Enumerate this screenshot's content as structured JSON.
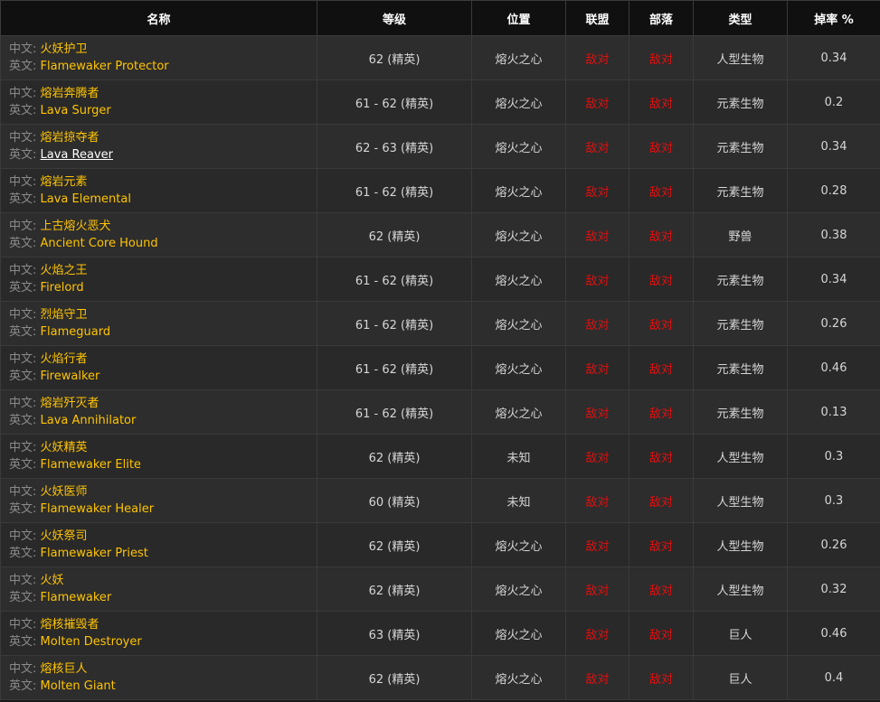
{
  "headers": {
    "name": "名称",
    "level": "等级",
    "location": "位置",
    "alliance": "联盟",
    "horde": "部落",
    "type": "类型",
    "droprate": "掉率 %"
  },
  "labels": {
    "cn": "中文:",
    "en": "英文:"
  },
  "rows": [
    {
      "cn": "火妖护卫",
      "en": "Flamewaker Protector",
      "level": "62 (精英)",
      "location": "熔火之心",
      "alliance": "敌对",
      "horde": "敌对",
      "type": "人型生物",
      "droprate": "0.34"
    },
    {
      "cn": "熔岩奔腾者",
      "en": "Lava Surger",
      "level": "61 - 62 (精英)",
      "location": "熔火之心",
      "alliance": "敌对",
      "horde": "敌对",
      "type": "元素生物",
      "droprate": "0.2"
    },
    {
      "cn": "熔岩掠夺者",
      "en": "Lava Reaver",
      "level": "62 - 63 (精英)",
      "location": "熔火之心",
      "alliance": "敌对",
      "horde": "敌对",
      "type": "元素生物",
      "droprate": "0.34"
    },
    {
      "cn": "熔岩元素",
      "en": "Lava Elemental",
      "level": "61 - 62 (精英)",
      "location": "熔火之心",
      "alliance": "敌对",
      "horde": "敌对",
      "type": "元素生物",
      "droprate": "0.28"
    },
    {
      "cn": "上古熔火恶犬",
      "en": "Ancient Core Hound",
      "level": "62 (精英)",
      "location": "熔火之心",
      "alliance": "敌对",
      "horde": "敌对",
      "type": "野兽",
      "droprate": "0.38"
    },
    {
      "cn": "火焰之王",
      "en": "Firelord",
      "level": "61 - 62 (精英)",
      "location": "熔火之心",
      "alliance": "敌对",
      "horde": "敌对",
      "type": "元素生物",
      "droprate": "0.34"
    },
    {
      "cn": "烈焰守卫",
      "en": "Flameguard",
      "level": "61 - 62 (精英)",
      "location": "熔火之心",
      "alliance": "敌对",
      "horde": "敌对",
      "type": "元素生物",
      "droprate": "0.26"
    },
    {
      "cn": "火焰行者",
      "en": "Firewalker",
      "level": "61 - 62 (精英)",
      "location": "熔火之心",
      "alliance": "敌对",
      "horde": "敌对",
      "type": "元素生物",
      "droprate": "0.46"
    },
    {
      "cn": "熔岩歼灭者",
      "en": "Lava Annihilator",
      "level": "61 - 62 (精英)",
      "location": "熔火之心",
      "alliance": "敌对",
      "horde": "敌对",
      "type": "元素生物",
      "droprate": "0.13"
    },
    {
      "cn": "火妖精英",
      "en": "Flamewaker Elite",
      "level": "62 (精英)",
      "location": "未知",
      "alliance": "敌对",
      "horde": "敌对",
      "type": "人型生物",
      "droprate": "0.3"
    },
    {
      "cn": "火妖医师",
      "en": "Flamewaker Healer",
      "level": "60 (精英)",
      "location": "未知",
      "alliance": "敌对",
      "horde": "敌对",
      "type": "人型生物",
      "droprate": "0.3"
    },
    {
      "cn": "火妖祭司",
      "en": "Flamewaker Priest",
      "level": "62 (精英)",
      "location": "熔火之心",
      "alliance": "敌对",
      "horde": "敌对",
      "type": "人型生物",
      "droprate": "0.26"
    },
    {
      "cn": "火妖",
      "en": "Flamewaker",
      "level": "62 (精英)",
      "location": "熔火之心",
      "alliance": "敌对",
      "horde": "敌对",
      "type": "人型生物",
      "droprate": "0.32"
    },
    {
      "cn": "熔核摧毁者",
      "en": "Molten Destroyer",
      "level": "63 (精英)",
      "location": "熔火之心",
      "alliance": "敌对",
      "horde": "敌对",
      "type": "巨人",
      "droprate": "0.46"
    },
    {
      "cn": "熔核巨人",
      "en": "Molten Giant",
      "level": "62 (精英)",
      "location": "熔火之心",
      "alliance": "敌对",
      "horde": "敌对",
      "type": "巨人",
      "droprate": "0.4"
    }
  ],
  "colors": {
    "header_bg": "#101010",
    "row_bg": "#2d2d2d",
    "name_highlight": "#ffc400",
    "hostile": "#e01010",
    "label_gray": "#8a8a8a"
  }
}
